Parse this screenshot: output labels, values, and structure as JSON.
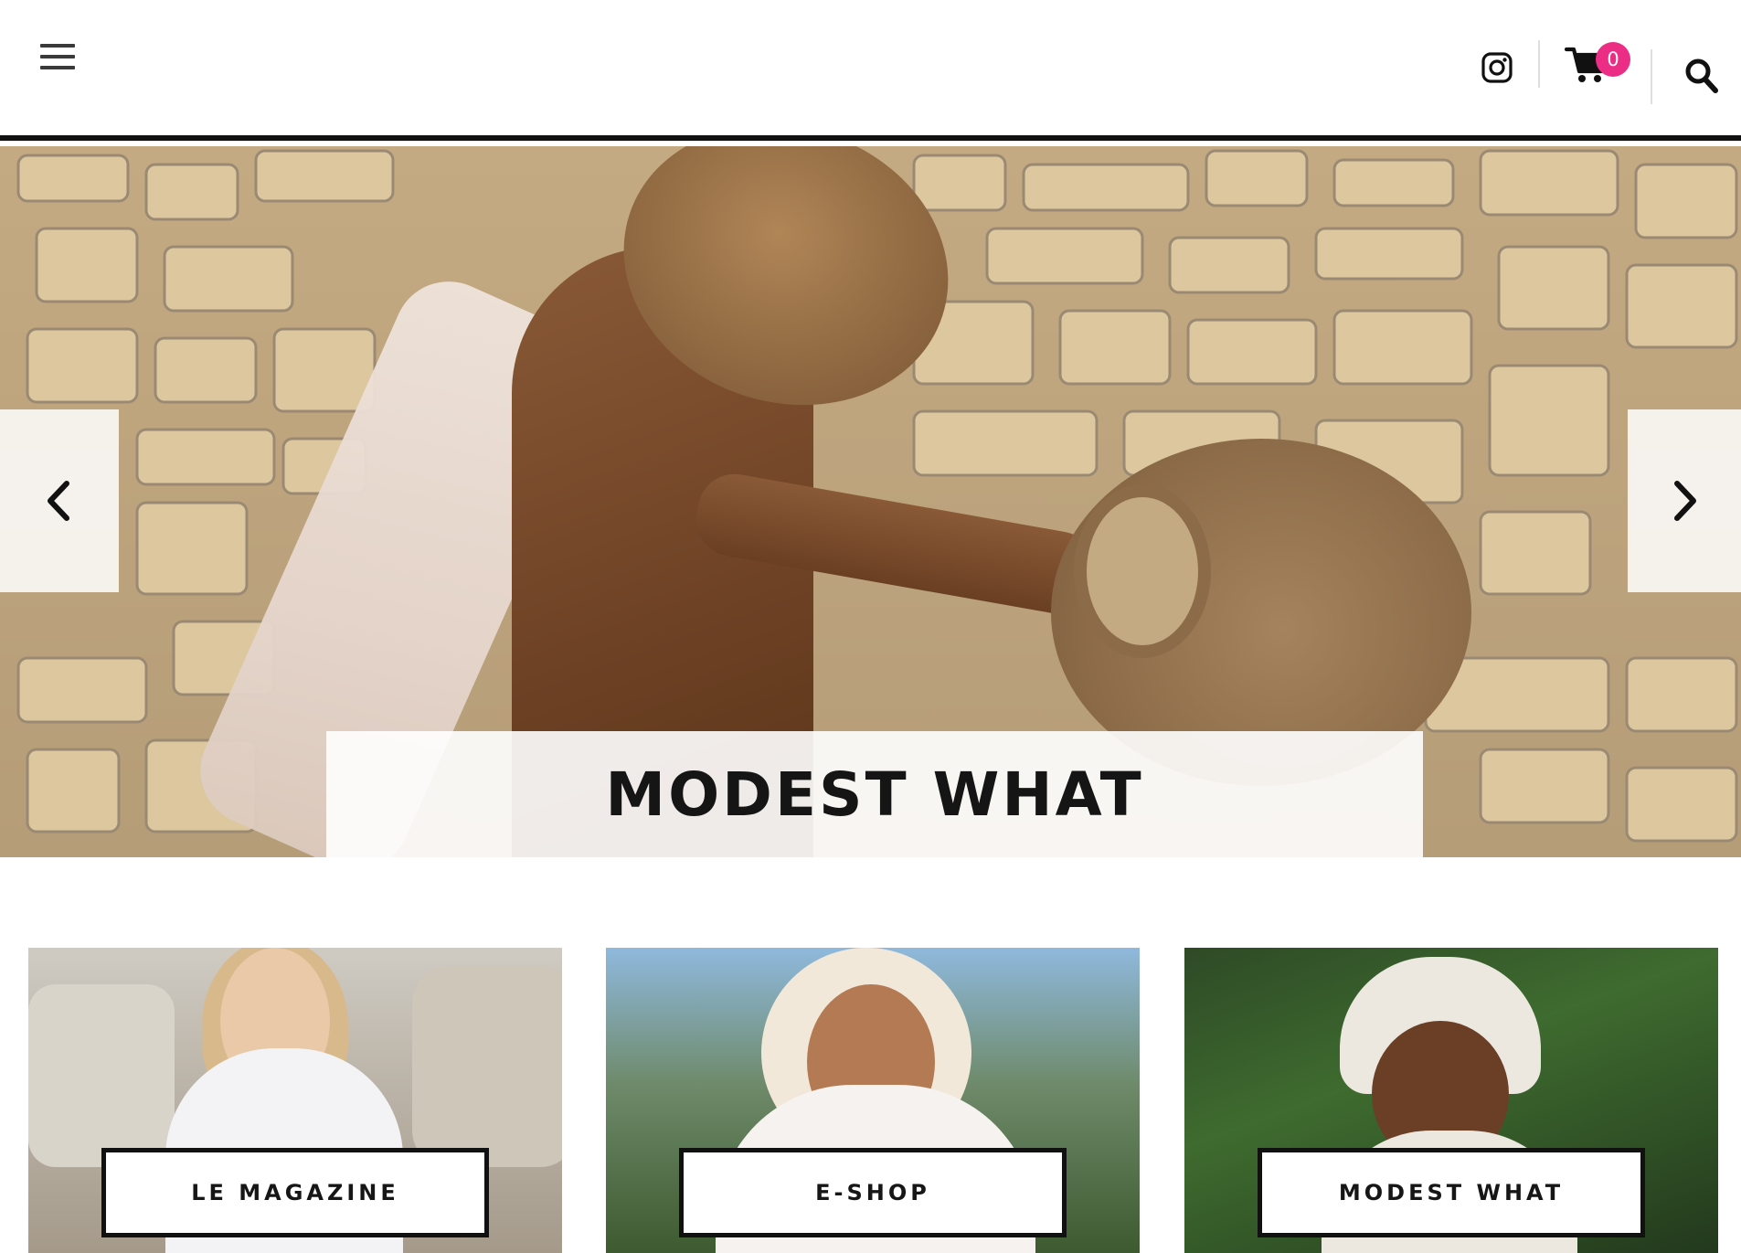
{
  "header": {
    "menu_icon": "hamburger-menu-icon",
    "instagram_icon": "instagram-icon",
    "cart_icon": "shopping-cart-icon",
    "cart_count": "0",
    "search_icon": "search-icon",
    "cart_badge_color": "#ec2d86"
  },
  "hero": {
    "title": "MODEST WHAT",
    "prev_icon": "chevron-left-icon",
    "next_icon": "chevron-right-icon"
  },
  "cards": [
    {
      "label": "LE MAGAZINE"
    },
    {
      "label": "E-SHOP"
    },
    {
      "label": "MODEST WHAT"
    }
  ]
}
